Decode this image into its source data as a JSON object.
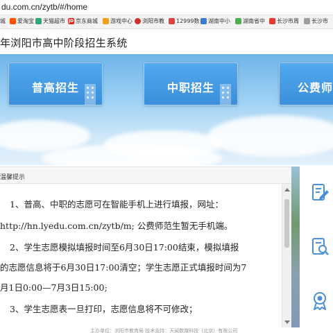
{
  "browser": {
    "address": "du.com.cn/zytb/#/home"
  },
  "bookmarks": [
    {
      "icon": "page-icon",
      "label": "城",
      "color": "#888888"
    },
    {
      "icon": "taobao-icon",
      "label": "爱淘宝",
      "color": "#ff5000"
    },
    {
      "icon": "tmall-icon",
      "label": "天猫超市",
      "color": "#2aa876"
    },
    {
      "icon": "jd-icon",
      "label": "京东商城",
      "color": "#e1251b"
    },
    {
      "icon": "game-icon",
      "label": "游戏中心",
      "color": "#f0a020"
    },
    {
      "icon": "liuyang-icon",
      "label": "浏阳市教",
      "color": "#d03030"
    },
    {
      "icon": "number-icon",
      "label": "12999数",
      "color": "#e04040"
    },
    {
      "icon": "hunan-icon",
      "label": "湖南中小",
      "color": "#3a7bd5"
    },
    {
      "icon": "hunan-province-icon",
      "label": "湖南省中",
      "color": "#4caf50"
    },
    {
      "icon": "changsha-icon",
      "label": "长沙市周",
      "color": "#e53935"
    },
    {
      "icon": "changsha2-icon",
      "label": "长沙市",
      "color": "#9e9e9e"
    }
  ],
  "header": {
    "title": "年浏阳市高中阶段招生系统"
  },
  "tiles": [
    {
      "label": "普高招生"
    },
    {
      "label": "中职招生"
    },
    {
      "label": "公费师"
    }
  ],
  "notice": {
    "heading": "温馨提示",
    "lines": [
      "1、普高、中职的志愿可在智能手机上进行填报，网址：",
      "http://hn.lyedu.com.cn/zytb/m; 公费师范生暂无手机端。",
      "2、学生志愿模拟填报时间至6月30日17:00结束，模拟填报",
      "的志愿信息将于6月30日17:00清空；学生志愿正式填报时间为7",
      "月1日0:00—7月3日15:00;",
      "3、学生志愿表一旦打印，志愿信息将不可修改；"
    ]
  },
  "sidebar_buttons": [
    {
      "icon": "edit-form-icon"
    },
    {
      "icon": "search-document-icon"
    },
    {
      "icon": "award-icon"
    }
  ],
  "footer": {
    "text": "主办单位：浏阳市教育局   技术支持：天闻数媒科技（北京）有限公司"
  },
  "colors": {
    "tile_blue": "#3b8fdb",
    "icon_blue": "#4a8fd8"
  }
}
